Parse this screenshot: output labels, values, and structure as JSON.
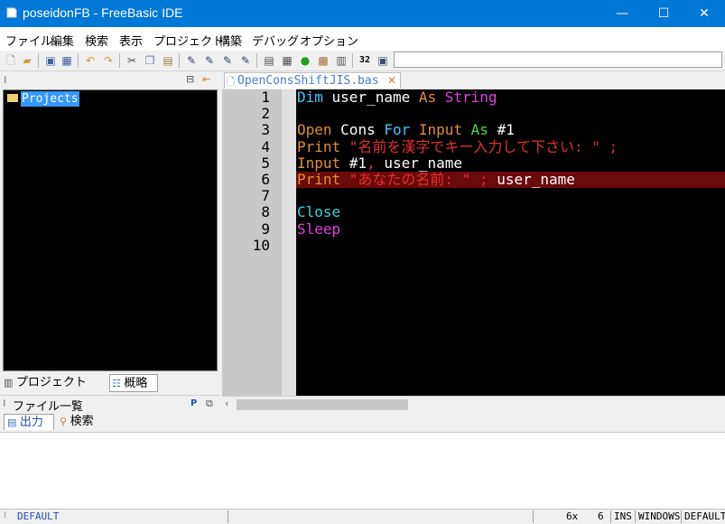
{
  "window": {
    "title": "poseidonFB - FreeBasic IDE",
    "minimize": "—",
    "maximize": "☐",
    "close": "✕"
  },
  "menu": [
    "ファイル",
    "編集",
    "検索",
    "表示",
    "プロジェクト",
    "構築",
    "デバッグ",
    "オプション"
  ],
  "toolbar": {
    "icons": [
      "new-file-icon",
      "open-icon",
      "save-icon",
      "save-all-icon",
      "undo-icon",
      "redo-icon",
      "cut-icon",
      "copy-icon",
      "paste-icon",
      "mark-icon",
      "mark-next-icon",
      "mark-prev-icon",
      "mark-clear-icon",
      "compile-icon",
      "build-icon",
      "run-icon",
      "rebuild-icon",
      "quick-run-icon",
      "console-icon",
      "bits-label",
      "window-icon"
    ],
    "bits_label": "32",
    "search_value": ""
  },
  "left_panel": {
    "tree_root": "Projects",
    "tabs": [
      "プロジェクト",
      "概略"
    ],
    "file_list_label": "ファイル一覧",
    "file_list_pin": "P"
  },
  "editor": {
    "tab_label": "OpenConsShiftJIS.bas",
    "tab_close": "✕",
    "line_numbers": [
      "1",
      "2",
      "3",
      "4",
      "5",
      "6",
      "7",
      "8",
      "9",
      "10"
    ],
    "lines": [
      [
        {
          "t": "Dim ",
          "c": "kw-blue"
        },
        {
          "t": "user_name ",
          "c": "txt-white"
        },
        {
          "t": "As ",
          "c": "kw-orange"
        },
        {
          "t": "String",
          "c": "kw-magenta"
        }
      ],
      [],
      [
        {
          "t": "Open ",
          "c": "kw-orange"
        },
        {
          "t": "Cons ",
          "c": "txt-white"
        },
        {
          "t": "For ",
          "c": "kw-blue"
        },
        {
          "t": "Input ",
          "c": "kw-orange"
        },
        {
          "t": "As ",
          "c": "kw-green"
        },
        {
          "t": "#1",
          "c": "txt-white"
        }
      ],
      [
        {
          "t": "Print ",
          "c": "kw-orange"
        },
        {
          "t": "\"名前を漢字でキー入力して下さい: \" ;",
          "c": "str-red"
        }
      ],
      [
        {
          "t": "Input ",
          "c": "kw-orange"
        },
        {
          "t": "#1",
          "c": "txt-white"
        },
        {
          "t": ", ",
          "c": "str-red"
        },
        {
          "t": "user_name",
          "c": "txt-white"
        }
      ],
      [
        {
          "t": "Print ",
          "c": "kw-orange"
        },
        {
          "t": "\"あなたの名前: \" ; ",
          "c": "str-red"
        },
        {
          "t": "user_name",
          "c": "txt-white"
        }
      ],
      [],
      [
        {
          "t": "Close",
          "c": "kw-cyan"
        }
      ],
      [
        {
          "t": "Sleep",
          "c": "kw-magenta"
        }
      ],
      []
    ]
  },
  "output_tabs": [
    "出力",
    "検索"
  ],
  "status": {
    "left": "DEFAULT",
    "col": "6x",
    "line": "6",
    "mode": "INS",
    "eol": "WINDOWS",
    "encoding": "DEFAULT"
  }
}
